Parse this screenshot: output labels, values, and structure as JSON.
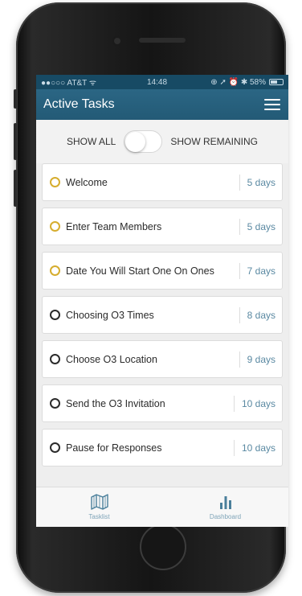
{
  "status_bar": {
    "carrier": "●●○○○ AT&T ᯤ",
    "time": "14:48",
    "indicators": "⊕ ➚ ⏰ ✱ 58%",
    "battery_level": 0.58
  },
  "header": {
    "title": "Active Tasks",
    "menu_icon": "hamburger-menu-icon"
  },
  "filter": {
    "left_label": "SHOW ALL",
    "right_label": "SHOW REMAINING",
    "selected": "SHOW ALL"
  },
  "tasks": [
    {
      "name": "Welcome",
      "duration": "5 days",
      "status": "pending"
    },
    {
      "name": "Enter Team Members",
      "duration": "5 days",
      "status": "pending"
    },
    {
      "name": "Date You Will Start One On Ones",
      "duration": "7 days",
      "status": "pending"
    },
    {
      "name": "Choosing O3 Times",
      "duration": "8 days",
      "status": "open"
    },
    {
      "name": "Choose O3 Location",
      "duration": "9 days",
      "status": "open"
    },
    {
      "name": "Send the O3 Invitation",
      "duration": "10 days",
      "status": "open"
    },
    {
      "name": "Pause for Responses",
      "duration": "10 days",
      "status": "open"
    }
  ],
  "tabs": [
    {
      "label": "Tasklist",
      "icon": "map-icon"
    },
    {
      "label": "Dashboard",
      "icon": "bar-chart-icon"
    }
  ],
  "colors": {
    "nav_blue": "#2b6684",
    "pending_circle": "#d6ad2e",
    "duration_text": "#5a89a2",
    "tab_icon": "#4a7f9b"
  }
}
